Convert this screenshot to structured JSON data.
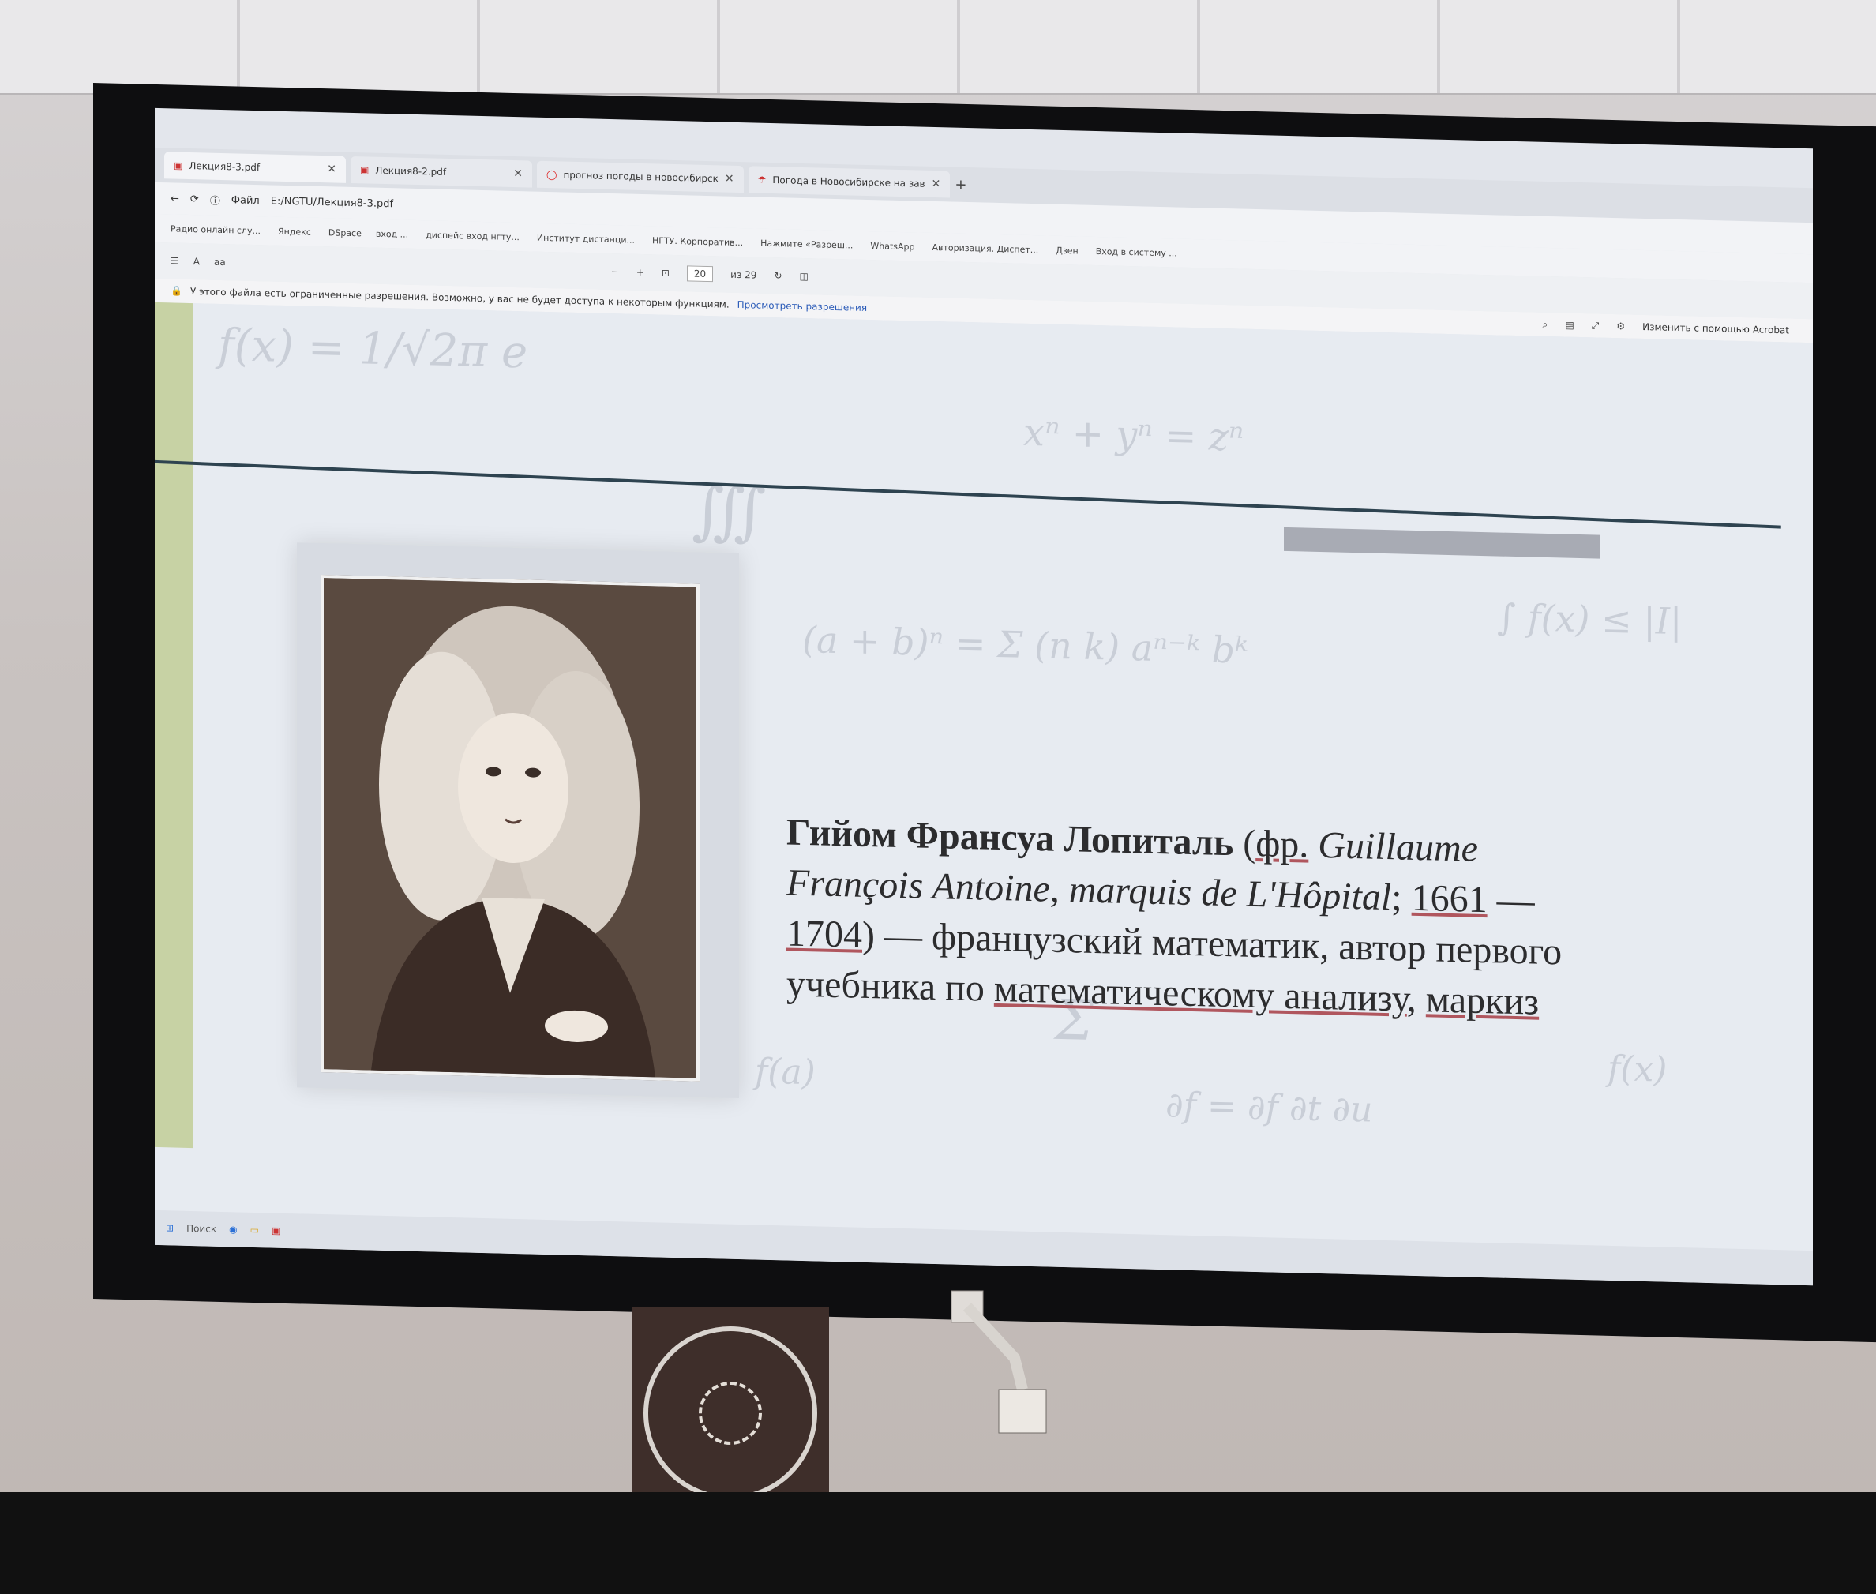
{
  "tabs": [
    {
      "label": "Лекция8-3.pdf",
      "active": true
    },
    {
      "label": "Лекция8-2.pdf",
      "active": false
    },
    {
      "label": "прогноз погоды в новосибирск",
      "active": false
    },
    {
      "label": "Погода в Новосибирске на зав",
      "active": false
    }
  ],
  "address": {
    "prefix": "Файл",
    "path": "E:/NGTU/Лекция8-3.pdf"
  },
  "bookmarks": [
    "Радио онлайн слу...",
    "Яндекс",
    "DSpace — вход ...",
    "диспейс вход нгту...",
    "Институт дистанци...",
    "НГТУ. Корпоратив...",
    "Нажмите «Разреш...",
    "WhatsApp",
    "Авторизация. Диспет...",
    "Дзен",
    "Вход в систему ..."
  ],
  "pdf_toolbar": {
    "zoom_out": "−",
    "zoom_in": "+",
    "page_current": "20",
    "page_total": "из 29"
  },
  "infobar": {
    "message": "У этого файла есть ограниченные разрешения. Возможно, у вас не будет доступа к некоторым функциям.",
    "link": "Просмотреть разрешения",
    "acrobat": "Изменить с помощью Acrobat"
  },
  "bio": {
    "name": "Гийом Франсуа Лопиталь",
    "lang": "фр.",
    "original_name": "Guillaume François Antoine, marquis de L'Hôpital",
    "year_birth": "1661",
    "year_death": "1704",
    "desc1": "— французский математик, автор первого учебника по",
    "link1": "математическому анализу",
    "link2": "маркиз"
  },
  "taskbar": {
    "search": "Поиск"
  },
  "formulas": [
    "f(x) = 1/√2π e",
    "xⁿ + yⁿ = zⁿ",
    "∭",
    "(a + b)ⁿ = Σ (n k) aⁿ⁻ᵏ bᵏ",
    "∫ f(x) ≤ |I|",
    "Σ",
    "f(a)",
    "∂f = ∂f ∂t ∂u",
    "f(x)"
  ]
}
